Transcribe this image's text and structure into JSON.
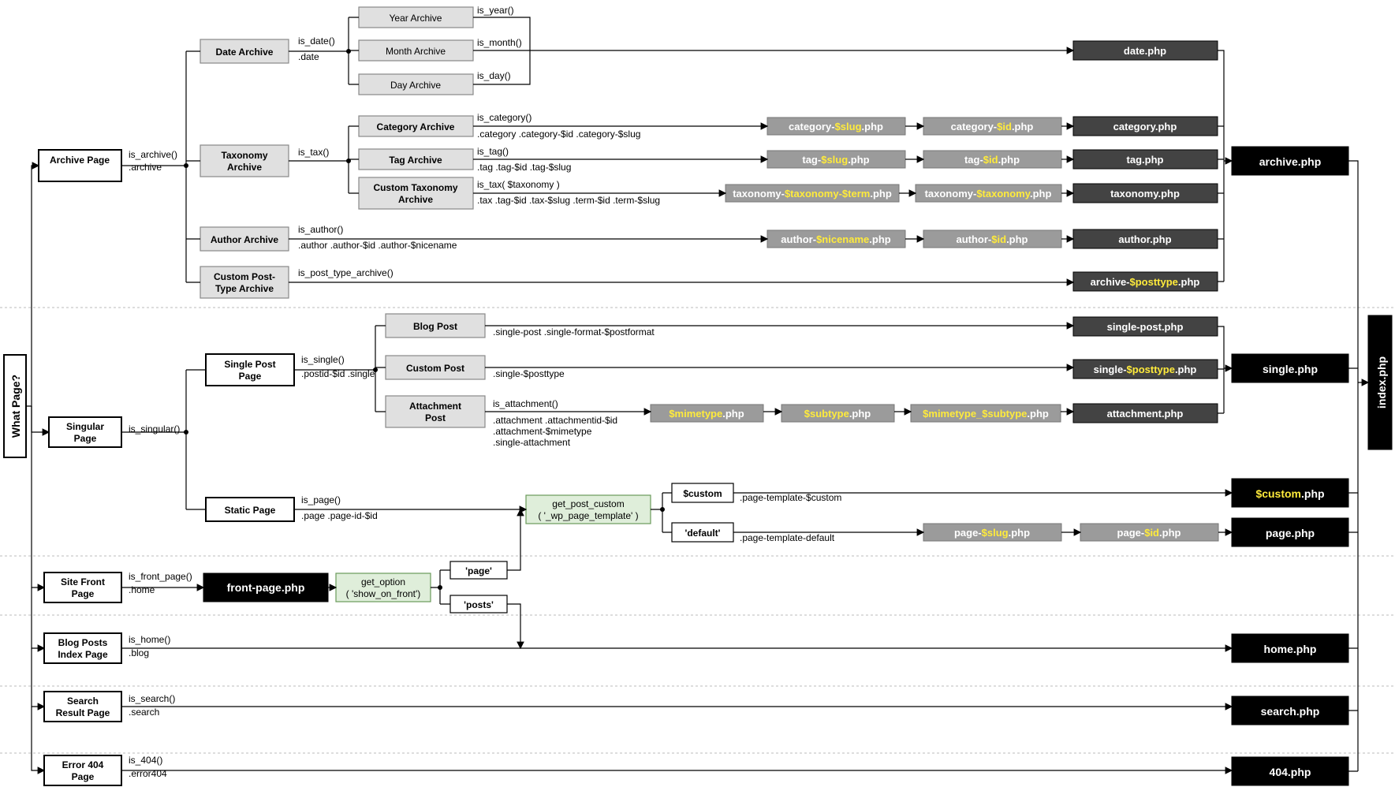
{
  "root": {
    "label": "What Page?"
  },
  "col1": {
    "archive": {
      "label": "Archive Page",
      "fn": "is_archive()",
      "cls": ".archive"
    },
    "singular": {
      "label": "Singular Page",
      "fn": "is_singular()"
    },
    "front": {
      "label": "Site Front Page",
      "fn": "is_front_page()",
      "cls": ".home"
    },
    "blog": {
      "label": "Blog Posts Index Page",
      "fn": "is_home()",
      "cls": ".blog"
    },
    "search": {
      "label": "Search Result Page",
      "fn": "is_search()",
      "cls": ".search"
    },
    "err": {
      "label": "Error 404 Page",
      "fn": "is_404()",
      "cls": ".error404"
    }
  },
  "archive_children": {
    "date": {
      "label": "Date Archive",
      "fn": "is_date()",
      "cls": ".date"
    },
    "tax": {
      "label": "Taxonomy Archive",
      "fn": "is_tax()"
    },
    "author": {
      "label": "Author Archive",
      "fn": "is_author()",
      "cls": ".author .author-$id .author-$nicename"
    },
    "cpt": {
      "label": "Custom Post-Type Archive",
      "fn": "is_post_type_archive()"
    }
  },
  "date_children": {
    "year": {
      "label": "Year Archive",
      "fn": "is_year()"
    },
    "month": {
      "label": "Month Archive",
      "fn": "is_month()"
    },
    "day": {
      "label": "Day Archive",
      "fn": "is_day()"
    }
  },
  "tax_children": {
    "cat": {
      "label": "Category Archive",
      "fn": "is_category()",
      "cls": ".category .category-$id .category-$slug"
    },
    "tag": {
      "label": "Tag Archive",
      "fn": "is_tag()",
      "cls": ".tag .tag-$id .tag-$slug"
    },
    "ctax": {
      "label": "Custom Taxonomy Archive",
      "fn": "is_tax( $taxonomy )",
      "cls": ".tax .tag-$id .tax-$slug .term-$id .term-$slug"
    }
  },
  "single_children": {
    "single": {
      "label": "Single Post Page",
      "fn": "is_single()",
      "cls": ".postid-$id .single"
    },
    "static": {
      "label": "Static Page",
      "fn": "is_page()",
      "cls": ".page .page-id-$id"
    }
  },
  "post_children": {
    "blog": {
      "label": "Blog Post",
      "cls": ".single-post .single-format-$postformat"
    },
    "custom": {
      "label": "Custom Post",
      "cls": ".single-$posttype"
    },
    "att": {
      "label": "Attachment Post",
      "fn": "is_attachment()",
      "cls1": ".attachment .attachmentid-$id",
      "cls2": ".attachment-$mimetype",
      "cls3": ".single-attachment"
    }
  },
  "static_flow": {
    "getpc": {
      "l1": "get_post_custom",
      "l2": "( '_wp_page_template' )"
    },
    "custom": {
      "label": "$custom",
      "cls": ".page-template-$custom"
    },
    "default": {
      "label": "'default'",
      "cls": ".page-template-default"
    }
  },
  "front_flow": {
    "getopt": {
      "l1": "get_option",
      "l2": "( 'show_on_front')"
    },
    "page": {
      "label": "'page'"
    },
    "posts": {
      "label": "'posts'"
    }
  },
  "gray_tpl": {
    "cat_slug": {
      "pre": "category-",
      "v": "$slug",
      "post": ".php"
    },
    "cat_id": {
      "pre": "category-",
      "v": "$id",
      "post": ".php"
    },
    "tag_slug": {
      "pre": "tag-",
      "v": "$slug",
      "post": ".php"
    },
    "tag_id": {
      "pre": "tag-",
      "v": "$id",
      "post": ".php"
    },
    "tx_full": {
      "pre": "taxonomy-",
      "v": "$taxonomy-$term",
      "post": ".php"
    },
    "tx": {
      "pre": "taxonomy-",
      "v": "$taxonomy",
      "post": ".php"
    },
    "au_nice": {
      "pre": "author-",
      "v": "$nicename",
      "post": ".php"
    },
    "au_id": {
      "pre": "author-",
      "v": "$id",
      "post": ".php"
    },
    "mime": {
      "v": "$mimetype",
      "post": ".php"
    },
    "sub": {
      "v": "$subtype",
      "post": ".php"
    },
    "mimesub": {
      "v": "$mimetype_$subtype",
      "post": ".php"
    },
    "page_slug": {
      "pre": "page-",
      "v": "$slug",
      "post": ".php"
    },
    "page_id": {
      "pre": "page-",
      "v": "$id",
      "post": ".php"
    }
  },
  "dark_tpl": {
    "date": "date.php",
    "cat": "category.php",
    "tag": "tag.php",
    "tax": "taxonomy.php",
    "author": "author.php",
    "cpt_pre": "archive-",
    "cpt_v": "$posttype",
    "cpt_post": ".php",
    "sp": "single-post.php",
    "sc_pre": "single-",
    "sc_v": "$posttype",
    "sc_post": ".php",
    "att": "attachment.php"
  },
  "black_tpl": {
    "archive": "archive.php",
    "single": "single.php",
    "custom_v": "$custom",
    "custom_post": ".php",
    "page": "page.php",
    "home": "home.php",
    "search": "search.php",
    "err": "404.php",
    "front": "front-page.php",
    "index": "index.php"
  }
}
